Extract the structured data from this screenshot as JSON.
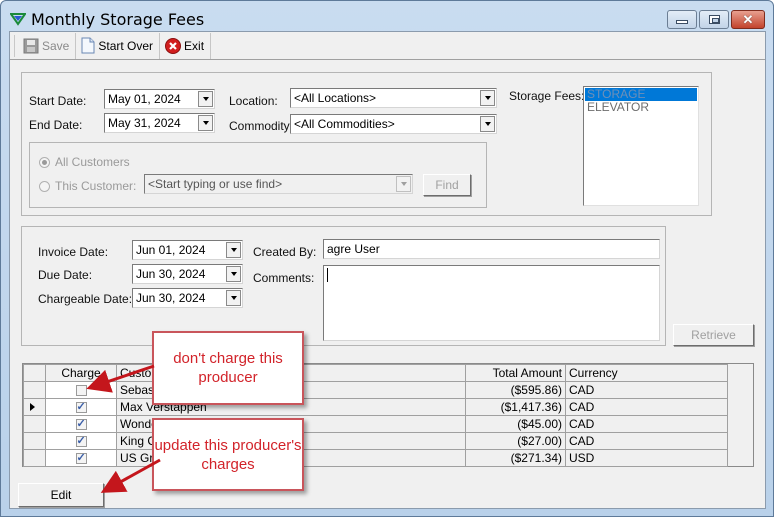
{
  "window": {
    "title": "Monthly Storage Fees",
    "controls": [
      "minimize",
      "maximize",
      "close"
    ]
  },
  "toolbar": {
    "save_label": "Save",
    "start_over_label": "Start Over",
    "exit_label": "Exit"
  },
  "filters": {
    "start_date_label": "Start Date:",
    "start_date": "May 01, 2024",
    "end_date_label": "End Date:",
    "end_date": "May 31, 2024",
    "location_label": "Location:",
    "location": "<All Locations>",
    "commodity_label": "Commodity:",
    "commodity": "<All Commodities>",
    "storage_fees_label": "Storage Fees:",
    "storage_fees_items": [
      {
        "label": "STORAGE",
        "selected": true
      },
      {
        "label": "ELEVATOR",
        "selected": false
      }
    ],
    "customers": {
      "all_label": "All Customers",
      "all_selected": true,
      "this_label": "This Customer:",
      "this_placeholder": "<Start typing or use find>",
      "find_label": "Find"
    }
  },
  "invoice": {
    "invoice_date_label": "Invoice Date:",
    "invoice_date": "Jun 01, 2024",
    "due_date_label": "Due Date:",
    "due_date": "Jun 30, 2024",
    "chargeable_date_label": "Chargeable Date:",
    "chargeable_date": "Jun 30, 2024",
    "created_by_label": "Created By:",
    "created_by": "agre User",
    "comments_label": "Comments:",
    "comments": "",
    "retrieve_label": "Retrieve"
  },
  "grid": {
    "columns": [
      "Charge",
      "Customer",
      "Total Amount",
      "Currency"
    ],
    "rows": [
      {
        "charge": false,
        "customer": "Sebasti",
        "total": "($595.86)",
        "currency": "CAD",
        "current": false
      },
      {
        "charge": true,
        "customer": "Max Verstappen",
        "total": "($1,417.36)",
        "currency": "CAD",
        "current": true
      },
      {
        "charge": true,
        "customer": "Wonder",
        "total": "($45.00)",
        "currency": "CAD",
        "current": false
      },
      {
        "charge": true,
        "customer": "King Ch",
        "total": "($27.00)",
        "currency": "CAD",
        "current": false
      },
      {
        "charge": true,
        "customer": "US Gra",
        "total": "($271.34)",
        "currency": "USD",
        "current": false
      }
    ]
  },
  "edit_label": "Edit",
  "annotations": {
    "callout1": "don't charge this producer",
    "callout2": "update this producer's charges",
    "color": "#d2232a"
  }
}
